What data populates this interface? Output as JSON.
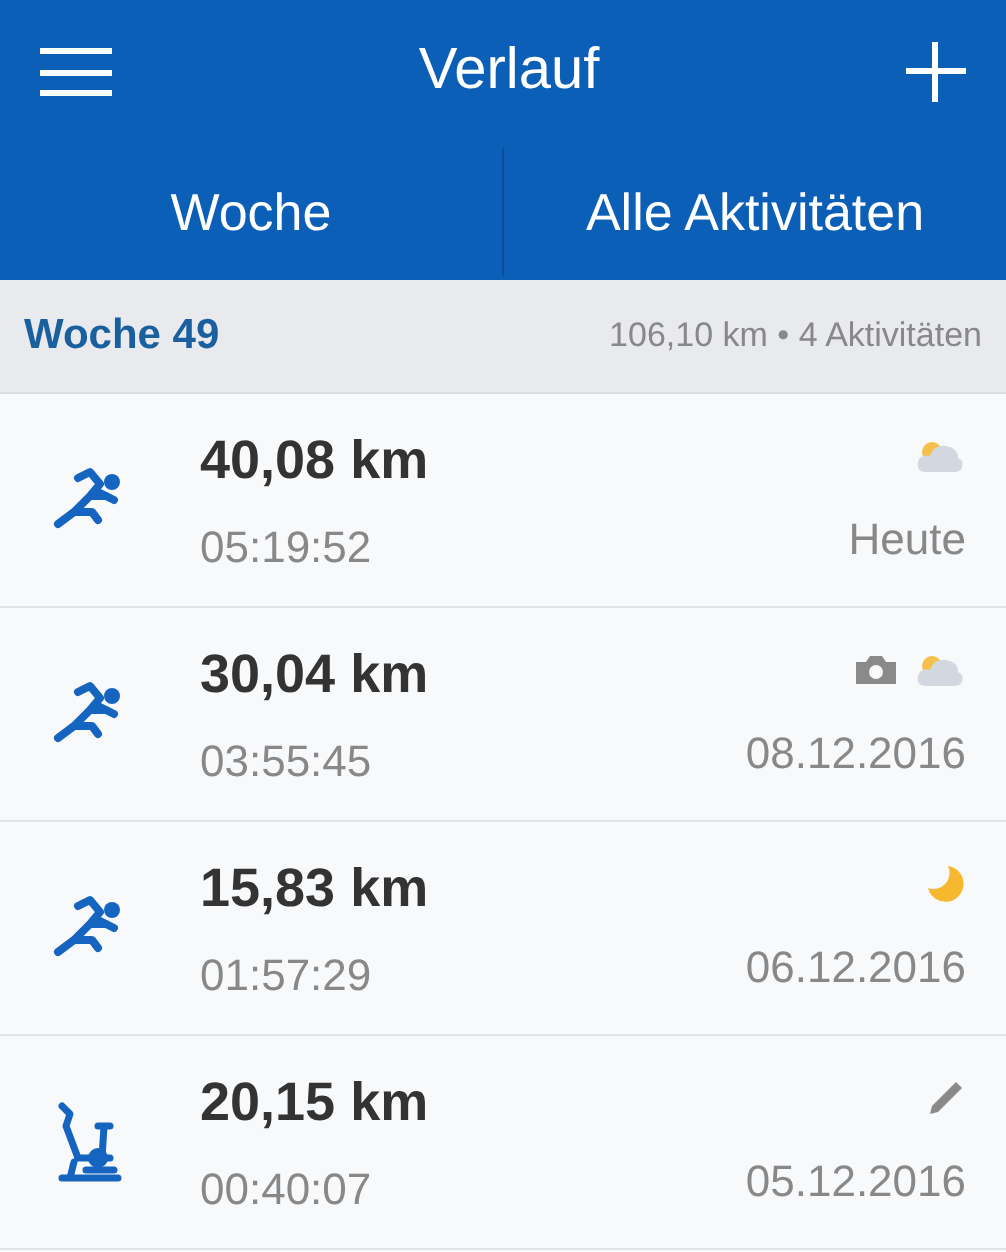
{
  "header": {
    "title": "Verlauf"
  },
  "tabs": [
    {
      "label": "Woche"
    },
    {
      "label": "Alle Aktivitäten"
    }
  ],
  "week": {
    "title": "Woche 49",
    "summary": "106,10 km • 4 Aktivitäten"
  },
  "activities": [
    {
      "kind": "run",
      "distance": "40,08 km",
      "duration": "05:19:52",
      "date": "Heute",
      "icons": [
        {
          "kind": "cloud"
        }
      ]
    },
    {
      "kind": "run",
      "distance": "30,04 km",
      "duration": "03:55:45",
      "date": "08.12.2016",
      "icons": [
        {
          "kind": "camera"
        },
        {
          "kind": "cloud"
        }
      ]
    },
    {
      "kind": "run",
      "distance": "15,83 km",
      "duration": "01:57:29",
      "date": "06.12.2016",
      "icons": [
        {
          "kind": "moon"
        }
      ]
    },
    {
      "kind": "bike",
      "distance": "20,15 km",
      "duration": "00:40:07",
      "date": "05.12.2016",
      "icons": [
        {
          "kind": "pencil"
        }
      ]
    }
  ]
}
